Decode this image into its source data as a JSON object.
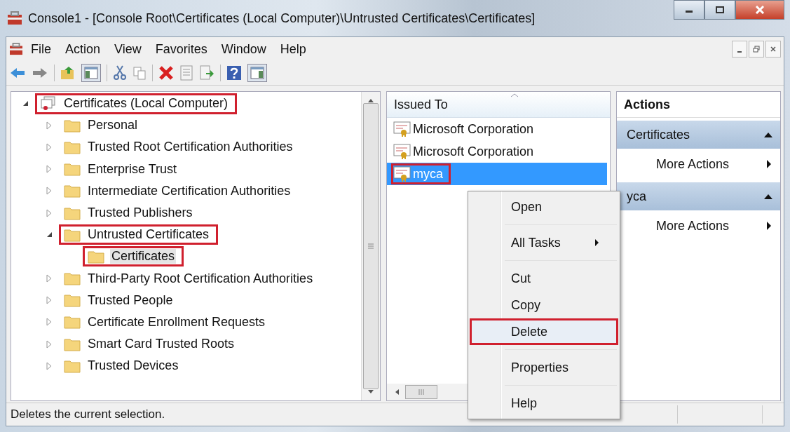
{
  "window": {
    "title": "Console1 - [Console Root\\Certificates (Local Computer)\\Untrusted Certificates\\Certificates]"
  },
  "menu_bar": [
    "File",
    "Action",
    "View",
    "Favorites",
    "Window",
    "Help"
  ],
  "tree": [
    {
      "label": "Certificates (Local Computer)",
      "kind": "store",
      "expandable": true,
      "expanded": true,
      "selected": false,
      "highlighted": true,
      "children": [
        {
          "label": "Personal",
          "kind": "folder",
          "expandable": true,
          "expanded": false,
          "selected": false,
          "highlighted": false
        },
        {
          "label": "Trusted Root Certification Authorities",
          "kind": "folder",
          "expandable": true,
          "expanded": false,
          "selected": false,
          "highlighted": false
        },
        {
          "label": "Enterprise Trust",
          "kind": "folder",
          "expandable": true,
          "expanded": false,
          "selected": false,
          "highlighted": false
        },
        {
          "label": "Intermediate Certification Authorities",
          "kind": "folder",
          "expandable": true,
          "expanded": false,
          "selected": false,
          "highlighted": false
        },
        {
          "label": "Trusted Publishers",
          "kind": "folder",
          "expandable": true,
          "expanded": false,
          "selected": false,
          "highlighted": false
        },
        {
          "label": "Untrusted Certificates",
          "kind": "folder",
          "expandable": true,
          "expanded": true,
          "selected": false,
          "highlighted": true,
          "children": [
            {
              "label": "Certificates",
              "kind": "folder",
              "expandable": false,
              "expanded": false,
              "selected": true,
              "highlighted": true
            }
          ]
        },
        {
          "label": "Third-Party Root Certification Authorities",
          "kind": "folder",
          "expandable": true,
          "expanded": false,
          "selected": false,
          "highlighted": false
        },
        {
          "label": "Trusted People",
          "kind": "folder",
          "expandable": true,
          "expanded": false,
          "selected": false,
          "highlighted": false
        },
        {
          "label": "Certificate Enrollment Requests",
          "kind": "folder",
          "expandable": true,
          "expanded": false,
          "selected": false,
          "highlighted": false
        },
        {
          "label": "Smart Card Trusted Roots",
          "kind": "folder",
          "expandable": true,
          "expanded": false,
          "selected": false,
          "highlighted": false
        },
        {
          "label": "Trusted Devices",
          "kind": "folder",
          "expandable": true,
          "expanded": false,
          "selected": false,
          "highlighted": false
        }
      ]
    }
  ],
  "list": {
    "column": "Issued To",
    "rows": [
      {
        "label": "Microsoft Corporation",
        "selected": false,
        "highlighted": false
      },
      {
        "label": "Microsoft Corporation",
        "selected": false,
        "highlighted": false
      },
      {
        "label": "myca",
        "selected": true,
        "highlighted": true
      }
    ]
  },
  "actions": {
    "title": "Actions",
    "sections": [
      {
        "header": "Certificates",
        "expanded": true,
        "items": [
          "More Actions"
        ]
      },
      {
        "header": "yca",
        "expanded": true,
        "items": [
          "More Actions"
        ]
      }
    ]
  },
  "context_menu": {
    "items": [
      {
        "kind": "item",
        "label": "Open",
        "highlighted": false
      },
      {
        "kind": "separator"
      },
      {
        "kind": "submenu",
        "label": "All Tasks",
        "highlighted": false
      },
      {
        "kind": "separator"
      },
      {
        "kind": "item",
        "label": "Cut",
        "highlighted": false
      },
      {
        "kind": "item",
        "label": "Copy",
        "highlighted": false
      },
      {
        "kind": "item",
        "label": "Delete",
        "highlighted": true
      },
      {
        "kind": "separator"
      },
      {
        "kind": "item",
        "label": "Properties",
        "highlighted": false
      },
      {
        "kind": "separator"
      },
      {
        "kind": "item",
        "label": "Help",
        "highlighted": false
      }
    ]
  },
  "status_bar": {
    "text": "Deletes the current selection."
  }
}
